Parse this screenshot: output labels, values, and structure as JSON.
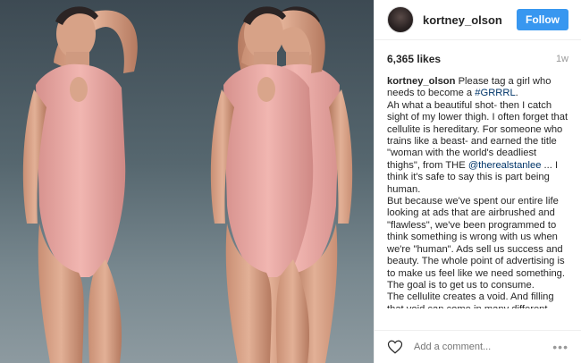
{
  "post": {
    "username": "kortney_olson",
    "follow_label": "Follow",
    "likes": "6,365 likes",
    "age": "1w",
    "caption": {
      "author": "kortney_olson",
      "lines": [
        " Please tag a girl who needs to become a ",
        "#GRRRL",
        ".",
        "Ah what a beautiful shot- then I catch sight of my lower thigh. I often forget that cellulite is hereditary. For someone who trains like a beast- and earned the title \"woman with the world's deadliest thighs\", from THE ",
        "@therealstanlee",
        " ... I think it's safe to say this is part being human.",
        "But because we've spent our entire life looking at ads that are airbrushed and \"flawless\", we've been programmed to think something is wrong with us when we're \"human\". Ads sell us success and beauty. The whole point of advertising is to make us feel like we need something. The goal is to get us to consume.",
        "The cellulite creates a void. And filling that void can come in many different forms. Alcohol. Over training. Fat freezing procedures. Eating disorders. Or like"
      ]
    },
    "comment_placeholder": "Add a comment...",
    "more_label": "•••"
  },
  "icons": {
    "heart": "heart-icon",
    "more": "more-options-icon"
  },
  "colors": {
    "follow_button": "#3897f0",
    "hashtag": "#003569",
    "suit": "#e9a7a4"
  }
}
